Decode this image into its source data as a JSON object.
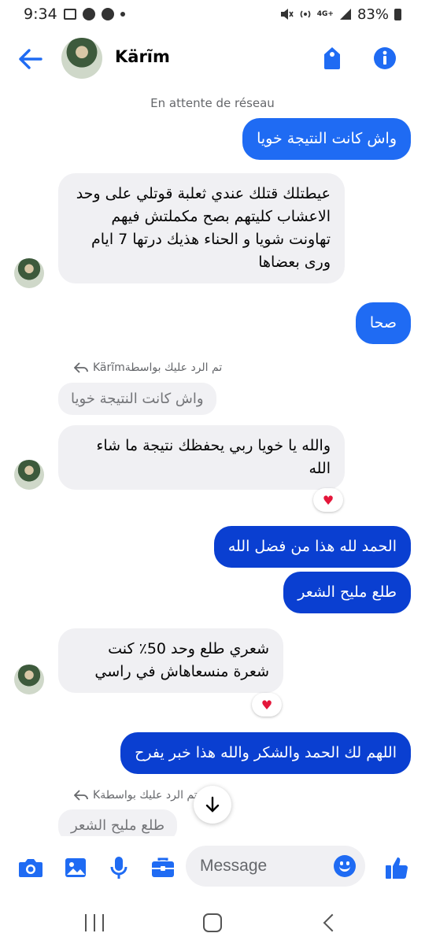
{
  "status_bar": {
    "time": "9:34",
    "network": "4G+",
    "battery": "83%"
  },
  "header": {
    "contact_name": "Kärĩm"
  },
  "system_note": "En attente de réseau",
  "messages": [
    {
      "dir": "out",
      "text": "واش كانت النتيجة خويا"
    },
    {
      "dir": "in",
      "text": "عيطتلك قتلك عندي ثعلبة قوتلي على وحد الاعشاب كليتهم بصح مكملتش فيهم تهاونت شويا و الحناء هذيك درتها 7 ايام وری بعضاها"
    },
    {
      "dir": "out",
      "text": "صحا"
    },
    {
      "dir": "reply_label",
      "text": "Kärĩmتم الرد عليك بواسطة"
    },
    {
      "dir": "quote",
      "text": "واش كانت النتيجة خويا"
    },
    {
      "dir": "in",
      "text": "والله يا خويا ربي يحفظك نتيجة ما شاء الله",
      "reaction": "♥"
    },
    {
      "dir": "out",
      "text": "الحمد لله هذا من فضل الله"
    },
    {
      "dir": "out",
      "text": "طلع مليح الشعر"
    },
    {
      "dir": "in",
      "text": "شعري طلع وحد 50٪ كنت شعرة منسعاهاش في راسي",
      "reaction": "♥"
    },
    {
      "dir": "out",
      "text": "اللهم لك الحمد والشكر والله هذا خبر يفرح"
    },
    {
      "dir": "reply_label",
      "text": "Kتم الرد عليك بواسطة"
    },
    {
      "dir": "quote",
      "text": "طلع مليح الشعر"
    }
  ],
  "composer": {
    "placeholder": "Message"
  },
  "colors": {
    "accent": "#1f6bf3",
    "accent_dark": "#0a3fd1",
    "incoming_bg": "#f0f0f3",
    "reaction": "#e4163a"
  }
}
